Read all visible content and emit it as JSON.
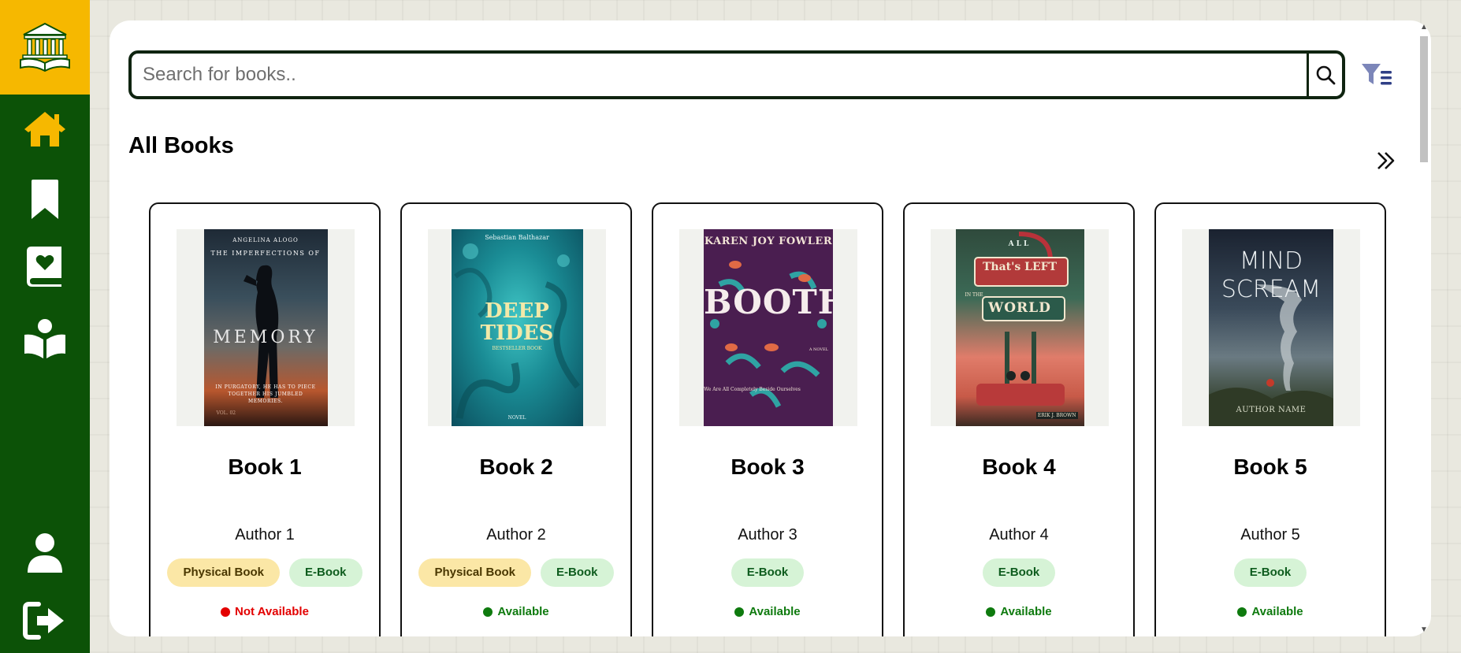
{
  "search": {
    "placeholder": "Search for books.."
  },
  "section": {
    "title": "All Books"
  },
  "colors": {
    "sidebar": "#0c5207",
    "logo_bg": "#f6b800",
    "active_nav": "#f6b800",
    "not_available": "#e30000",
    "available": "#0e7a0e",
    "filter_icon": "#2f3f86"
  },
  "sidebar": {
    "items": [
      {
        "name": "home",
        "icon": "home-icon",
        "active": true
      },
      {
        "name": "saved",
        "icon": "bookmark-icon",
        "active": false
      },
      {
        "name": "favorites",
        "icon": "favorite-book-icon",
        "active": false
      },
      {
        "name": "reading",
        "icon": "reader-icon",
        "active": false
      },
      {
        "name": "profile",
        "icon": "user-icon",
        "active": false
      },
      {
        "name": "logout",
        "icon": "logout-icon",
        "active": false
      }
    ]
  },
  "books": [
    {
      "title": "Book 1",
      "author": "Author 1",
      "tags": [
        "Physical Book",
        "E-Book"
      ],
      "availability": "Not Available",
      "available": false,
      "rating": 0,
      "cover": {
        "top": "ANGELINA ALOGO",
        "subtitle": "THE IMPERFECTIONS OF",
        "main": "MEMORY",
        "blurb": "IN PURGATORY, HE HAS TO PIECE TOGETHER HIS JUMBLED MEMORIES.",
        "foot": "VOL. 02"
      }
    },
    {
      "title": "Book 2",
      "author": "Author 2",
      "tags": [
        "Physical Book",
        "E-Book"
      ],
      "availability": "Available",
      "available": true,
      "rating": 0,
      "cover": {
        "top": "Sebastian Balthazar",
        "main1": "DEEP",
        "main2": "TIDES",
        "sub": "BESTSELLER BOOK",
        "foot": "NOVEL"
      }
    },
    {
      "title": "Book 3",
      "author": "Author 3",
      "tags": [
        "E-Book"
      ],
      "availability": "Available",
      "available": true,
      "rating": 0,
      "cover": {
        "top": "KAREN JOY FOWLER",
        "main": "BOOTH",
        "side": "A NOVEL",
        "blurb": "We Are All Completely Beside Ourselves"
      }
    },
    {
      "title": "Book 4",
      "author": "Author 4",
      "tags": [
        "E-Book"
      ],
      "availability": "Available",
      "available": true,
      "rating": 0,
      "cover": {
        "top": "ALL",
        "main1": "That's LEFT",
        "in": "IN THE",
        "main2": "WORLD",
        "foot": "ERIK J. BROWN"
      }
    },
    {
      "title": "Book 5",
      "author": "Author 5",
      "tags": [
        "E-Book"
      ],
      "availability": "Available",
      "available": true,
      "rating": 0,
      "cover": {
        "main1": "MIND",
        "main2": "SCREAM",
        "foot": "AUTHOR NAME"
      }
    }
  ]
}
